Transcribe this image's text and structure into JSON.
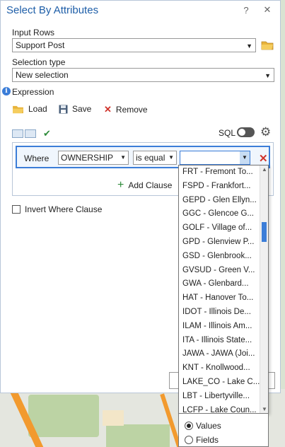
{
  "window": {
    "title": "Select By Attributes",
    "help": "?",
    "close": "✕"
  },
  "input_rows": {
    "label": "Input Rows",
    "value": "Support Post"
  },
  "selection_type": {
    "label": "Selection type",
    "value": "New selection"
  },
  "expression": {
    "label": "Expression",
    "load": "Load",
    "save": "Save",
    "remove": "Remove"
  },
  "sql": {
    "label": "SQL",
    "enabled": false
  },
  "clause": {
    "where": "Where",
    "field": "OWNERSHIP",
    "operator": "is equal",
    "value": ""
  },
  "add_clause": "Add Clause",
  "invert_where": "Invert Where Clause",
  "dropdown_items": [
    "FRT - Fremont To...",
    "FSPD - Frankfort...",
    "GEPD - Glen Ellyn...",
    "GGC - Glencoe G...",
    "GOLF - Village of...",
    "GPD - Glenview P...",
    "GSD - Glenbrook...",
    "GVSUD - Green V...",
    "GWA - Glenbard...",
    "HAT - Hanover To...",
    "IDOT - Illinois De...",
    "ILAM - Illinois Am...",
    "ITA - Illinois State...",
    "JAWA - JAWA (Joi...",
    "KNT - Knollwood...",
    "LAKE_CO - Lake C...",
    "LBT - Libertyville...",
    "LCFP - Lake Coun..."
  ],
  "radio": {
    "values": "Values",
    "fields": "Fields",
    "selected": "values"
  },
  "colors": {
    "accent": "#3b7dd8",
    "title": "#1e5ea8",
    "remove": "#d0342c",
    "add": "#2e8b3a"
  }
}
